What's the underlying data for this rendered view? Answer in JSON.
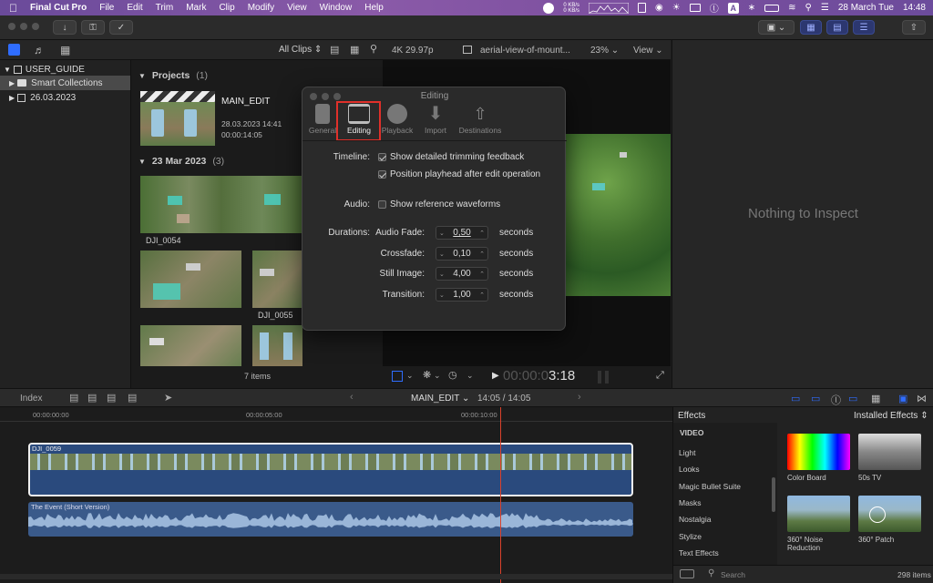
{
  "menubar": {
    "app": "Final Cut Pro",
    "items": [
      "File",
      "Edit",
      "Trim",
      "Mark",
      "Clip",
      "Modify",
      "View",
      "Window",
      "Help"
    ],
    "net_up": "0 KB/s",
    "net_down": "0 KB/s",
    "date": "28 March Tue",
    "time": "14:48"
  },
  "browser": {
    "filter": "All Clips",
    "libraries": [
      {
        "label": "USER_GUIDE"
      },
      {
        "label": "Smart Collections"
      },
      {
        "label": "26.03.2023"
      }
    ],
    "projects_title": "Projects",
    "projects_count": "(1)",
    "project": {
      "name": "MAIN_EDIT",
      "date": "28.03.2023 14:41",
      "duration": "00:00:14:05"
    },
    "event_title": "23 Mar 2023",
    "event_count": "(3)",
    "clips": [
      "DJI_0054",
      "DJI_0055"
    ],
    "items_count": "7 items"
  },
  "viewer": {
    "format": "4K 29.97p",
    "clip_name": "aerial-view-of-mount...",
    "zoom": "23%",
    "view_menu": "View",
    "timecode_dim": "00:00:0",
    "timecode_bright": "3:18"
  },
  "inspector": {
    "empty_text": "Nothing to Inspect"
  },
  "prefs": {
    "title": "Editing",
    "tabs": [
      "General",
      "Editing",
      "Playback",
      "Import",
      "Destinations"
    ],
    "timeline_label": "Timeline:",
    "timeline_opt1": "Show detailed trimming feedback",
    "timeline_opt2": "Position playhead after edit operation",
    "audio_label": "Audio:",
    "audio_opt": "Show reference waveforms",
    "durations_label": "Durations:",
    "rows": [
      {
        "label": "Audio Fade:",
        "value": "0,50",
        "unit": "seconds"
      },
      {
        "label": "Crossfade:",
        "value": "0,10",
        "unit": "seconds"
      },
      {
        "label": "Still Image:",
        "value": "4,00",
        "unit": "seconds"
      },
      {
        "label": "Transition:",
        "value": "1,00",
        "unit": "seconds"
      }
    ]
  },
  "timeline": {
    "index_label": "Index",
    "project_name": "MAIN_EDIT",
    "position": "14:05 / 14:05",
    "ruler": [
      "00:00:00:00",
      "00:00:05:00",
      "00:00:10:00"
    ],
    "video_clip": "DJI_0059",
    "audio_clip": "The Event (Short Version)"
  },
  "effects": {
    "title": "Effects",
    "installed": "Installed Effects",
    "category_header": "VIDEO",
    "categories": [
      "Light",
      "Looks",
      "Magic Bullet Suite",
      "Masks",
      "Nostalgia",
      "Stylize",
      "Text Effects"
    ],
    "tiles": [
      "Color Board",
      "50s TV",
      "360° Noise Reduction",
      "360° Patch"
    ],
    "search_placeholder": "Search",
    "count": "298 items"
  },
  "colors": {
    "accent_blue": "#2f6dff",
    "highlight_red": "#e0302a",
    "playhead": "#d9412b"
  }
}
